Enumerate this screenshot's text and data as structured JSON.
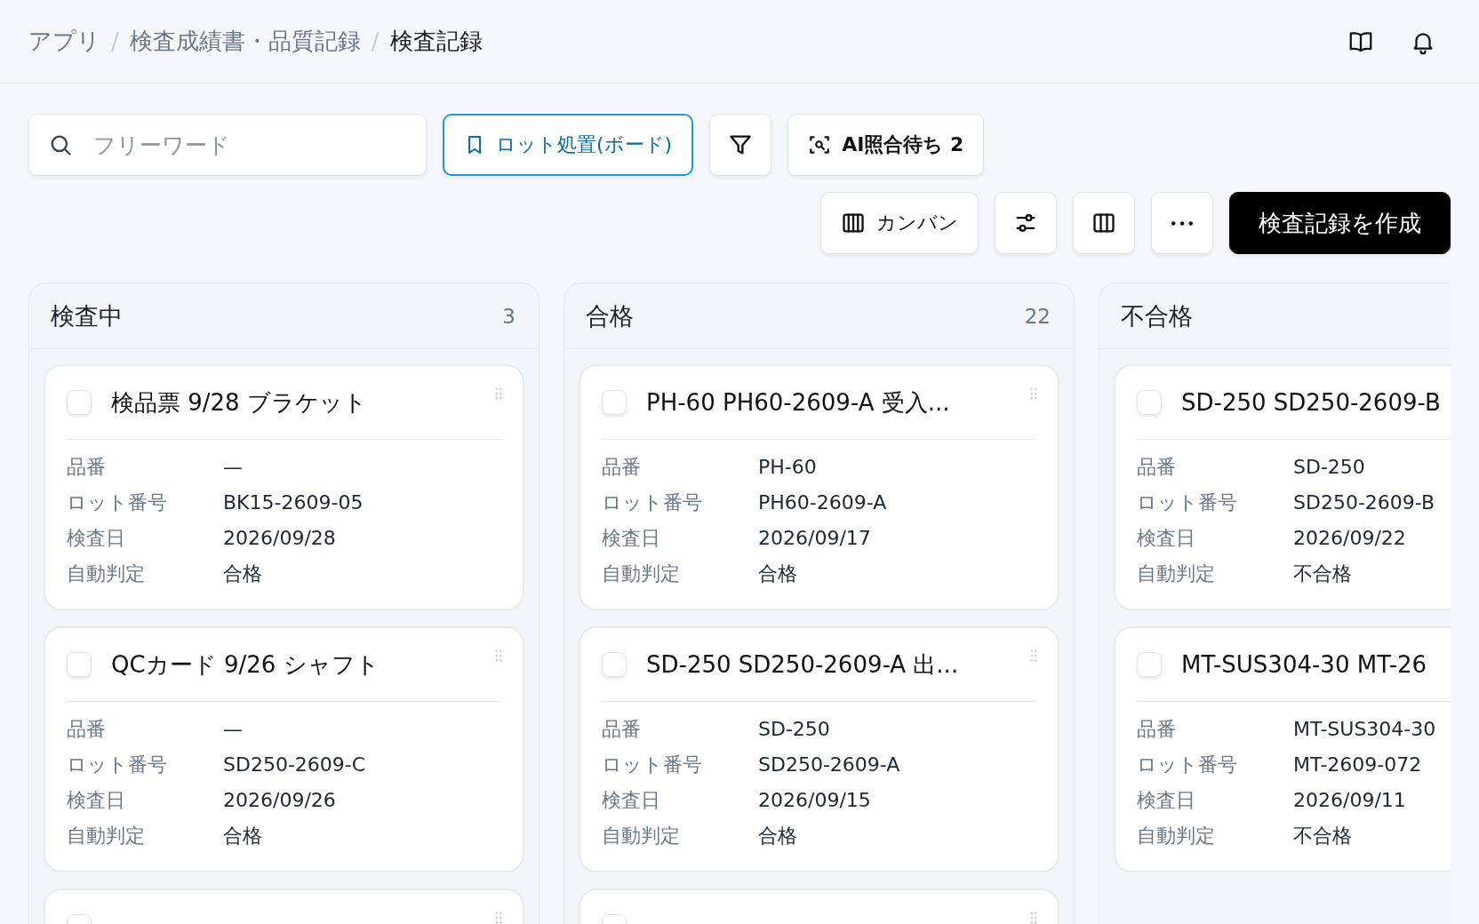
{
  "breadcrumb": [
    {
      "kind": "link",
      "label": "アプリ"
    },
    {
      "kind": "separator",
      "label": "/"
    },
    {
      "kind": "link",
      "label": "検査成績書・品質記録"
    },
    {
      "kind": "separator",
      "label": "/"
    },
    {
      "kind": "current",
      "label": "検査記録"
    }
  ],
  "toolbar": {
    "search": {
      "placeholder": "フリーワード"
    },
    "board_toggle": {
      "label": "ロット処置(ボード)",
      "active": true
    },
    "ai_button": {
      "label": "AI照合待ち",
      "count": "2"
    },
    "view_button": {
      "label": "カンバン"
    },
    "create_button": {
      "label": "検査記録を作成"
    }
  },
  "columns": [
    {
      "title": "検査中",
      "count": "3",
      "cards": [
        {
          "kind": "full",
          "title": "検品票 9/28 ブラケット",
          "checked": false,
          "handle": true,
          "fields": [
            {
              "label": "品番",
              "value": "—"
            },
            {
              "label": "ロット番号",
              "value": "BK15-2609-05"
            },
            {
              "label": "検査日",
              "value": "2026/09/28"
            },
            {
              "label": "自動判定",
              "value": "合格"
            }
          ]
        },
        {
          "kind": "full",
          "title": "QCカード 9/26 シャフト",
          "checked": false,
          "handle": true,
          "fields": [
            {
              "label": "品番",
              "value": "—"
            },
            {
              "label": "ロット番号",
              "value": "SD250-2609-C"
            },
            {
              "label": "検査日",
              "value": "2026/09/26"
            },
            {
              "label": "自動判定",
              "value": "合格"
            }
          ]
        },
        {
          "kind": "stub",
          "checked": false,
          "handle": true
        }
      ]
    },
    {
      "title": "合格",
      "count": "22",
      "cards": [
        {
          "kind": "full",
          "title": "PH-60 PH60-2609-A 受入...",
          "checked": false,
          "handle": true,
          "fields": [
            {
              "label": "品番",
              "value": "PH-60"
            },
            {
              "label": "ロット番号",
              "value": "PH60-2609-A"
            },
            {
              "label": "検査日",
              "value": "2026/09/17"
            },
            {
              "label": "自動判定",
              "value": "合格"
            }
          ]
        },
        {
          "kind": "full",
          "title": "SD-250 SD250-2609-A 出...",
          "checked": false,
          "handle": true,
          "fields": [
            {
              "label": "品番",
              "value": "SD-250"
            },
            {
              "label": "ロット番号",
              "value": "SD250-2609-A"
            },
            {
              "label": "検査日",
              "value": "2026/09/15"
            },
            {
              "label": "自動判定",
              "value": "合格"
            }
          ]
        },
        {
          "kind": "stub",
          "checked": false,
          "handle": true
        }
      ]
    },
    {
      "title": "不合格",
      "cards": [
        {
          "kind": "full",
          "title": "SD-250 SD250-2609-B",
          "checked": false,
          "fields": [
            {
              "label": "品番",
              "value": "SD-250"
            },
            {
              "label": "ロット番号",
              "value": "SD250-2609-B"
            },
            {
              "label": "検査日",
              "value": "2026/09/22"
            },
            {
              "label": "自動判定",
              "value": "不合格"
            }
          ]
        },
        {
          "kind": "full",
          "title": "MT-SUS304-30 MT-26",
          "checked": false,
          "fields": [
            {
              "label": "品番",
              "value": "MT-SUS304-30"
            },
            {
              "label": "ロット番号",
              "value": "MT-2609-072"
            },
            {
              "label": "検査日",
              "value": "2026/09/11"
            },
            {
              "label": "自動判定",
              "value": "不合格"
            }
          ]
        }
      ]
    }
  ]
}
